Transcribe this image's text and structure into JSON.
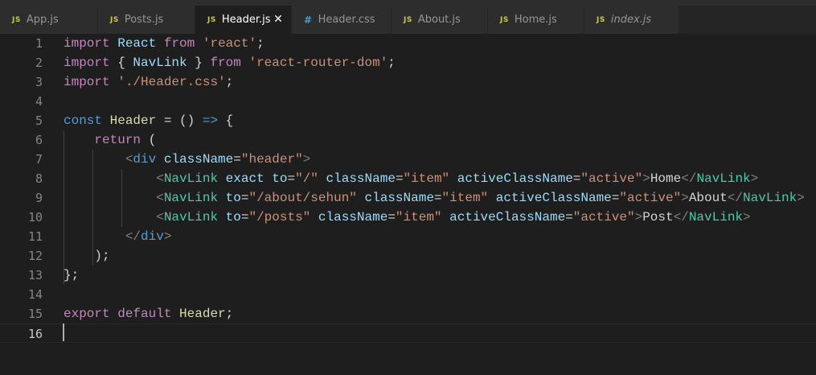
{
  "tabs": [
    {
      "icon": "JS",
      "name": "App.js",
      "active": false
    },
    {
      "icon": "JS",
      "name": "Posts.js",
      "active": false
    },
    {
      "icon": "JS",
      "name": "Header.js",
      "active": true
    },
    {
      "icon": "#",
      "name": "Header.css",
      "active": false
    },
    {
      "icon": "JS",
      "name": "About.js",
      "active": false
    },
    {
      "icon": "JS",
      "name": "Home.js",
      "active": false
    },
    {
      "icon": "JS",
      "name": "index.js",
      "active": false,
      "italic": true
    }
  ],
  "close_glyph": "✕",
  "line_numbers": [
    "1",
    "2",
    "3",
    "4",
    "5",
    "6",
    "7",
    "8",
    "9",
    "10",
    "11",
    "12",
    "13",
    "14",
    "15",
    "16"
  ],
  "current_line": "16",
  "code": {
    "l1": [
      "import",
      " ",
      "React",
      " ",
      "from",
      " ",
      "'react'",
      ";"
    ],
    "l2": [
      "import",
      " { ",
      "NavLink",
      " } ",
      "from",
      " ",
      "'react-router-dom'",
      ";"
    ],
    "l3": [
      "import",
      " ",
      "'./Header.css'",
      ";"
    ],
    "l5": [
      "const",
      " ",
      "Header",
      " = () ",
      "=>",
      " {"
    ],
    "l6": [
      "    ",
      "return",
      " ("
    ],
    "l7": [
      "        ",
      "<",
      "div",
      " ",
      "className",
      "=",
      "\"header\"",
      ">"
    ],
    "l8": [
      "            ",
      "<",
      "NavLink",
      " ",
      "exact",
      " ",
      "to",
      "=",
      "\"/\"",
      " ",
      "className",
      "=",
      "\"item\"",
      " ",
      "activeClassName",
      "=",
      "\"active\"",
      ">",
      "Home",
      "</",
      "NavLink",
      ">"
    ],
    "l9": [
      "            ",
      "<",
      "NavLink",
      " ",
      "to",
      "=",
      "\"/about/sehun\"",
      " ",
      "className",
      "=",
      "\"item\"",
      " ",
      "activeClassName",
      "=",
      "\"active\"",
      ">",
      "About",
      "</",
      "NavLink",
      ">"
    ],
    "l10": [
      "            ",
      "<",
      "NavLink",
      " ",
      "to",
      "=",
      "\"/posts\"",
      " ",
      "className",
      "=",
      "\"item\"",
      " ",
      "activeClassName",
      "=",
      "\"active\"",
      ">",
      "Post",
      "</",
      "NavLink",
      ">"
    ],
    "l11": [
      "        ",
      "</",
      "div",
      ">"
    ],
    "l12": [
      "    ",
      ");"
    ],
    "l13": [
      "};"
    ],
    "l15": [
      "export",
      " ",
      "default",
      " ",
      "Header",
      ";"
    ]
  },
  "colors": {
    "background": "#1e1e1e",
    "keyword_import": "#c586c0",
    "keyword_decl": "#569cd6",
    "identifier": "#9cdcfe",
    "component": "#4ec9b0",
    "string": "#ce9178",
    "tag_bracket": "#808080",
    "js_icon": "#cbcb41",
    "css_icon": "#519aba"
  }
}
